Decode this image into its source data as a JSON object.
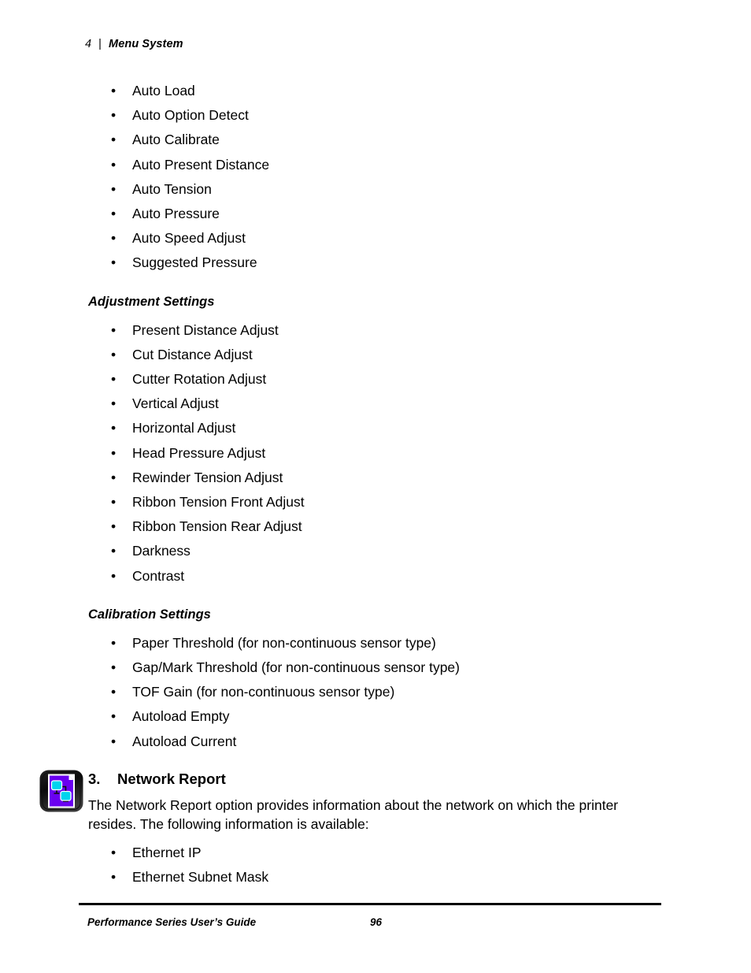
{
  "header": {
    "chapter_number": "4",
    "separator": "|",
    "chapter_title": "Menu System"
  },
  "content": {
    "intro_list": [
      "Auto Load",
      "Auto Option Detect",
      "Auto Calibrate",
      "Auto Present Distance",
      "Auto Tension",
      "Auto Pressure",
      "Auto Speed Adjust",
      "Suggested Pressure"
    ],
    "adjustment": {
      "heading": "Adjustment Settings",
      "items": [
        "Present Distance Adjust",
        "Cut Distance Adjust",
        "Cutter Rotation Adjust",
        "Vertical Adjust",
        "Horizontal Adjust",
        "Head Pressure Adjust",
        "Rewinder Tension Adjust",
        "Ribbon Tension Front Adjust",
        "Ribbon Tension Rear Adjust",
        "Darkness",
        "Contrast"
      ]
    },
    "calibration": {
      "heading": "Calibration Settings",
      "items": [
        "Paper Threshold (for non-continuous sensor type)",
        "Gap/Mark Threshold (for non-continuous sensor type)",
        "TOF Gain (for non-continuous sensor type)",
        "Autoload Empty",
        "Autoload Current"
      ]
    },
    "network_report": {
      "icon": "network-report-icon",
      "number": "3.",
      "title": "Network Report",
      "paragraph": "The Network Report option provides information about the network on which the printer resides. The following information is available:",
      "items": [
        "Ethernet IP",
        "Ethernet Subnet Mask"
      ]
    },
    "bullet_glyph": "•"
  },
  "footer": {
    "document_title": "Performance Series User’s Guide",
    "page_number": "96"
  },
  "colors": {
    "text": "#000000",
    "page_background": "#ffffff",
    "icon_frame": "#0d0d0d",
    "icon_page": "#6a00f0",
    "icon_monitor": "#00d4ee",
    "icon_border": "#ffffff"
  }
}
